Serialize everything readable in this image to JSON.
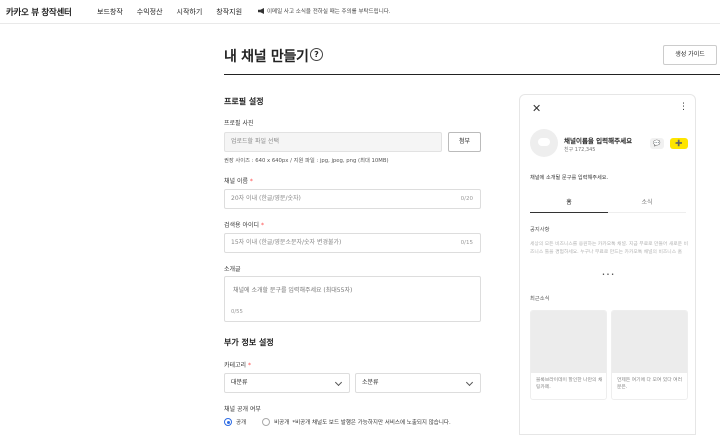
{
  "header": {
    "brand": "카카오 뷰 창작센터",
    "nav": [
      "보드창작",
      "수익정산",
      "시작하기",
      "창작지원"
    ],
    "notice": "이메일 사고 소식을 전하실 때는 주의를 부탁드립니다."
  },
  "page": {
    "title": "내 채널 만들기",
    "help_glyph": "?",
    "guide_button": "생성 가이드"
  },
  "profile": {
    "section_title": "프로필 설정",
    "photo_label": "프로필 사진",
    "photo_placeholder": "업로드할 파일 선택",
    "attach_button": "첨부",
    "photo_hint": "권장 사이즈 : 640 x 640px / 지원 파일 : jpg, jpeg, png (최대 10MB)",
    "name_label": "채널 이름",
    "name_placeholder": "20자 이내 (한글/영문/숫자)",
    "name_count": "0/20",
    "search_id_label": "검색용 아이디",
    "search_id_placeholder": "15자 이내 (한글/영문소문자/숫자 변경불가)",
    "search_id_count": "0/15",
    "intro_label": "소개글",
    "intro_placeholder": "채널에 소개할 문구를 입력해주세요 (최대55자)",
    "intro_count": "0/55",
    "required_mark": "*"
  },
  "extra": {
    "section_title": "부가 정보 설정",
    "category_label": "카테고리",
    "category_main": "대분류",
    "category_sub": "소분류",
    "visibility_label": "채널 공개 여부",
    "public_label": "공개",
    "private_label": "비공개",
    "private_note": "*비공개 채널도 보드 발행은 가능하지만 서비스에 노출되지 않습니다.",
    "visibility_value": "공개"
  },
  "preview": {
    "close_glyph": "✕",
    "more_glyph": "⋮",
    "channel_name": "채널이름을 입력해주세요",
    "friends": "친구 172,345",
    "chat_glyph": "💬",
    "add_glyph": "➕",
    "intro": "채널에 소개될 문구를 입력해주세요.",
    "tabs": [
      "홈",
      "소식"
    ],
    "notice_title": "공지사항",
    "notice_text": "세상의 모든 비즈니스를 응원하는 카카오톡 채널. 지금 무료로 만들어 새로운 비즈니스 툴을 경험하세요. 누구나 무료로 만드는 카카오톡 채널의 비즈니스 홈",
    "dots": "• • •",
    "recent_title": "최근소식",
    "cards": [
      "블록브라이데이 할인한 나만의 채팅카페.",
      "언제든 여기에 다 모여 있다 여러분은."
    ]
  },
  "colors": {
    "accent_yellow": "#fee500",
    "required_red": "#ff4d4d",
    "radio_blue": "#2d6be4"
  }
}
